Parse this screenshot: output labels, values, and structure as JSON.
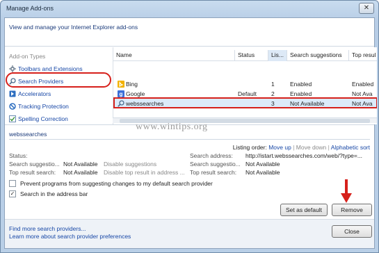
{
  "window": {
    "title": "Manage Add-ons",
    "close_glyph": "✕"
  },
  "header": {
    "text": "View and manage your Internet Explorer add-ons"
  },
  "left": {
    "heading": "Add-on Types",
    "items": [
      {
        "label": "Toolbars and Extensions",
        "icon": "gear-icon"
      },
      {
        "label": "Search Providers",
        "icon": "search-icon"
      },
      {
        "label": "Accelerators",
        "icon": "accelerator-icon"
      },
      {
        "label": "Tracking Protection",
        "icon": "tracking-protection-icon"
      },
      {
        "label": "Spelling Correction",
        "icon": "spelling-icon"
      }
    ]
  },
  "table": {
    "columns": [
      "Name",
      "Status",
      "Lis...",
      "Search suggestions",
      "Top resul"
    ],
    "rows": [
      {
        "icon": "bing-icon",
        "name": "Bing",
        "status": "",
        "order": "1",
        "suggestions": "Enabled",
        "top": "Enabled"
      },
      {
        "icon": "google-icon",
        "name": "Google",
        "status": "Default",
        "order": "2",
        "suggestions": "Enabled",
        "top": "Not Ava"
      },
      {
        "icon": "search-icon",
        "name": "webssearches",
        "status": "",
        "order": "3",
        "suggestions": "Not Available",
        "top": "Not Ava"
      }
    ]
  },
  "details": {
    "name": "webssearches",
    "listing_label": "Listing order:",
    "move_up": "Move up",
    "sep1": "|",
    "move_down": "Move down",
    "sep2": "|",
    "alphabetic": "Alphabetic sort",
    "status_label": "Status:",
    "search_suggestions_label": "Search suggestio...",
    "search_suggestions_value": "Not Available",
    "disable_suggestions": "Disable suggestions",
    "top_result_label": "Top result search:",
    "top_result_value": "Not Available",
    "disable_top_result": "Disable top result in address ...",
    "search_address_label": "Search address:",
    "search_address_value": "http://istart.webssearches.com/web/?type=...",
    "r_suggestions_label": "Search suggestio...",
    "r_suggestions_value": "Not Available",
    "r_top_label": "Top result search:",
    "r_top_value": "Not Available",
    "prevent_label": "Prevent programs from suggesting changes to my default search provider",
    "prevent_checked": false,
    "address_bar_label": "Search in the address bar",
    "address_bar_checked": true,
    "check_glyph": "✓",
    "set_default": "Set as default",
    "remove": "Remove"
  },
  "footer": {
    "find_more": "Find more search providers...",
    "learn_more": "Learn more about search provider preferences",
    "close": "Close"
  },
  "watermark": "www.wintips.org",
  "colors": {
    "highlight": "#d6201b",
    "link": "#1747a6",
    "arrow": "#d6201b"
  }
}
